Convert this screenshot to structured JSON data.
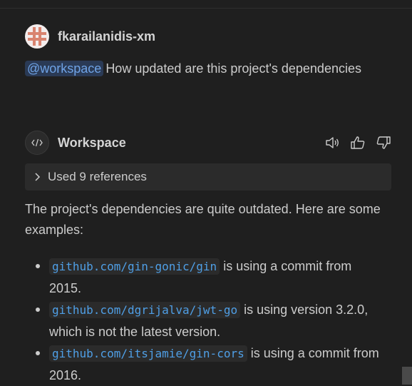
{
  "user": {
    "name": "fkarailanidis-xm",
    "mention": "@workspace",
    "message": "How updated are this project's dependencies"
  },
  "assistant": {
    "name": "Workspace",
    "actions": [
      "speaker-icon",
      "thumbs-up-icon",
      "thumbs-down-icon"
    ],
    "references_label": "Used 9 references",
    "intro": "The project's dependencies are quite outdated. Here are some examples:",
    "items": [
      {
        "code": "github.com/gin-gonic/gin",
        "text": " is using a commit from 2015."
      },
      {
        "code": "github.com/dgrijalva/jwt-go",
        "text": " is using version 3.2.0, which is not the latest version."
      },
      {
        "code": "github.com/itsjamie/gin-cors",
        "text": " is using a commit from 2016."
      }
    ]
  },
  "colors": {
    "background": "#1f1f1f",
    "mention_bg": "#2a3a55",
    "link": "#4f9fe6",
    "panel": "#2b2b2b"
  }
}
